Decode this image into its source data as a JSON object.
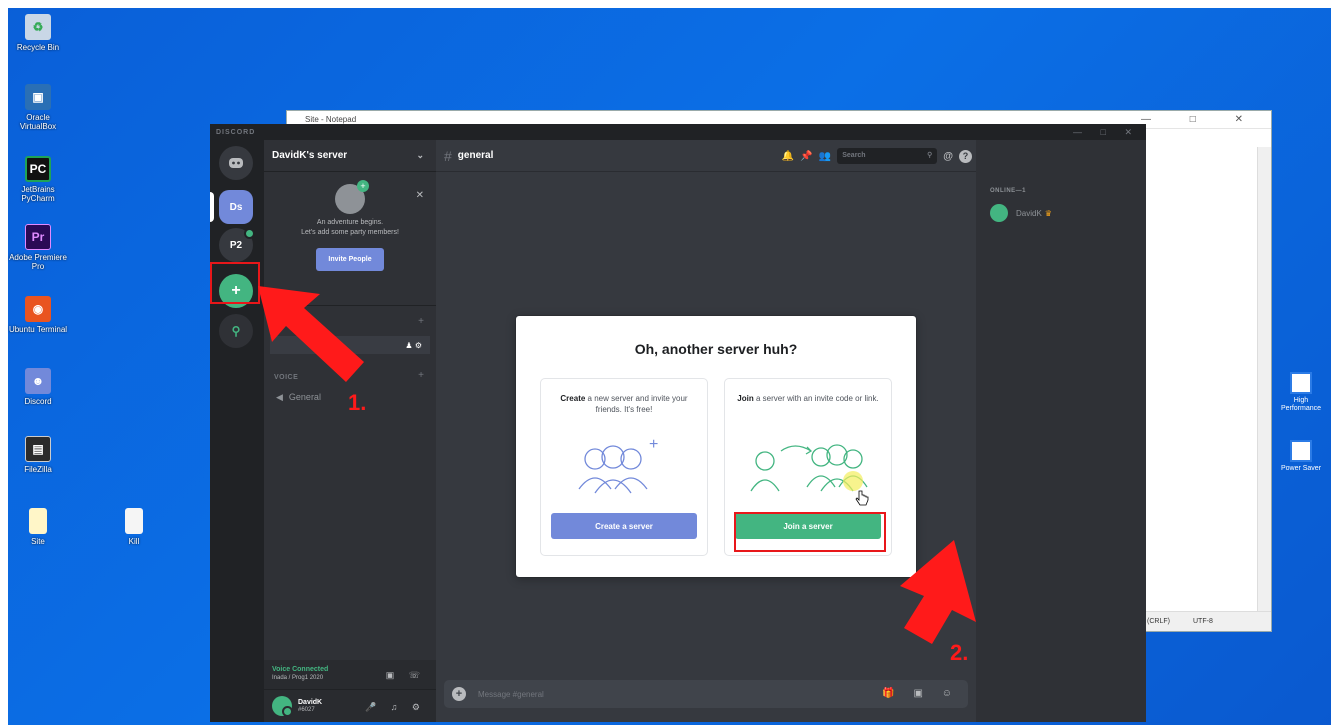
{
  "desktop": {
    "icons": [
      {
        "label": "Recycle Bin",
        "icon": "recycle-bin-icon",
        "color": "#c9d7e6"
      },
      {
        "label": "Oracle VirtualBox",
        "icon": "virtualbox-icon",
        "color": "#2a6fb5"
      },
      {
        "label": "JetBrains PyCharm",
        "icon": "pycharm-icon",
        "color": "#1fa356"
      },
      {
        "label": "Adobe Premiere Pro",
        "icon": "premiere-icon",
        "color": "#2a0a55"
      },
      {
        "label": "Ubuntu Terminal",
        "icon": "ubuntu-icon",
        "color": "#e95420"
      },
      {
        "label": "Discord",
        "icon": "discord-icon",
        "color": "#7289da"
      },
      {
        "label": "FileZilla",
        "icon": "filezilla-icon",
        "color": "#2b2b2b"
      },
      {
        "label": "Site",
        "icon": "file-icon",
        "color": "#fff6c8"
      },
      {
        "label": "Kill",
        "icon": "file-icon",
        "color": "#f5f5f5"
      }
    ],
    "right_icons": [
      {
        "label": "High Performance",
        "icon": "power-plan-icon"
      },
      {
        "label": "Power Saver",
        "icon": "power-plan-icon"
      }
    ]
  },
  "notepad": {
    "title": "Site - Notepad",
    "status_eol": "(CRLF)",
    "status_enc": "UTF-8"
  },
  "discord": {
    "app_title": "DISCORD",
    "window_controls": "— □ ✕",
    "guilds": [
      {
        "label": "Ds"
      },
      {
        "label": "P2"
      }
    ],
    "server_name": "DavidK's server",
    "invite_card": {
      "line1": "An adventure begins.",
      "line2": "Let's add some party members!",
      "button": "Invite People"
    },
    "categories": {
      "voice": "VOICE"
    },
    "voice_channel": "General",
    "voice_status": "Voice Connected",
    "voice_sub": "Inada / Prog1 2020",
    "user": {
      "name": "DavidK",
      "tag": "#6027"
    },
    "channel": "general",
    "search_placeholder": "Search",
    "message_placeholder": "Message #general",
    "members": {
      "header": "ONLINE—1",
      "list": [
        {
          "name": "DavidK"
        }
      ]
    },
    "modal": {
      "title": "Oh, another server huh?",
      "create": {
        "bold": "Create",
        "text": " a new server and invite your friends. It's free!",
        "button": "Create a server"
      },
      "join": {
        "bold": "Join",
        "text": " a server with an invite code or link.",
        "button": "Join a server"
      }
    }
  },
  "annotations": {
    "step1": "1.",
    "step2": "2.",
    "highlight_color": "#e8171a"
  }
}
